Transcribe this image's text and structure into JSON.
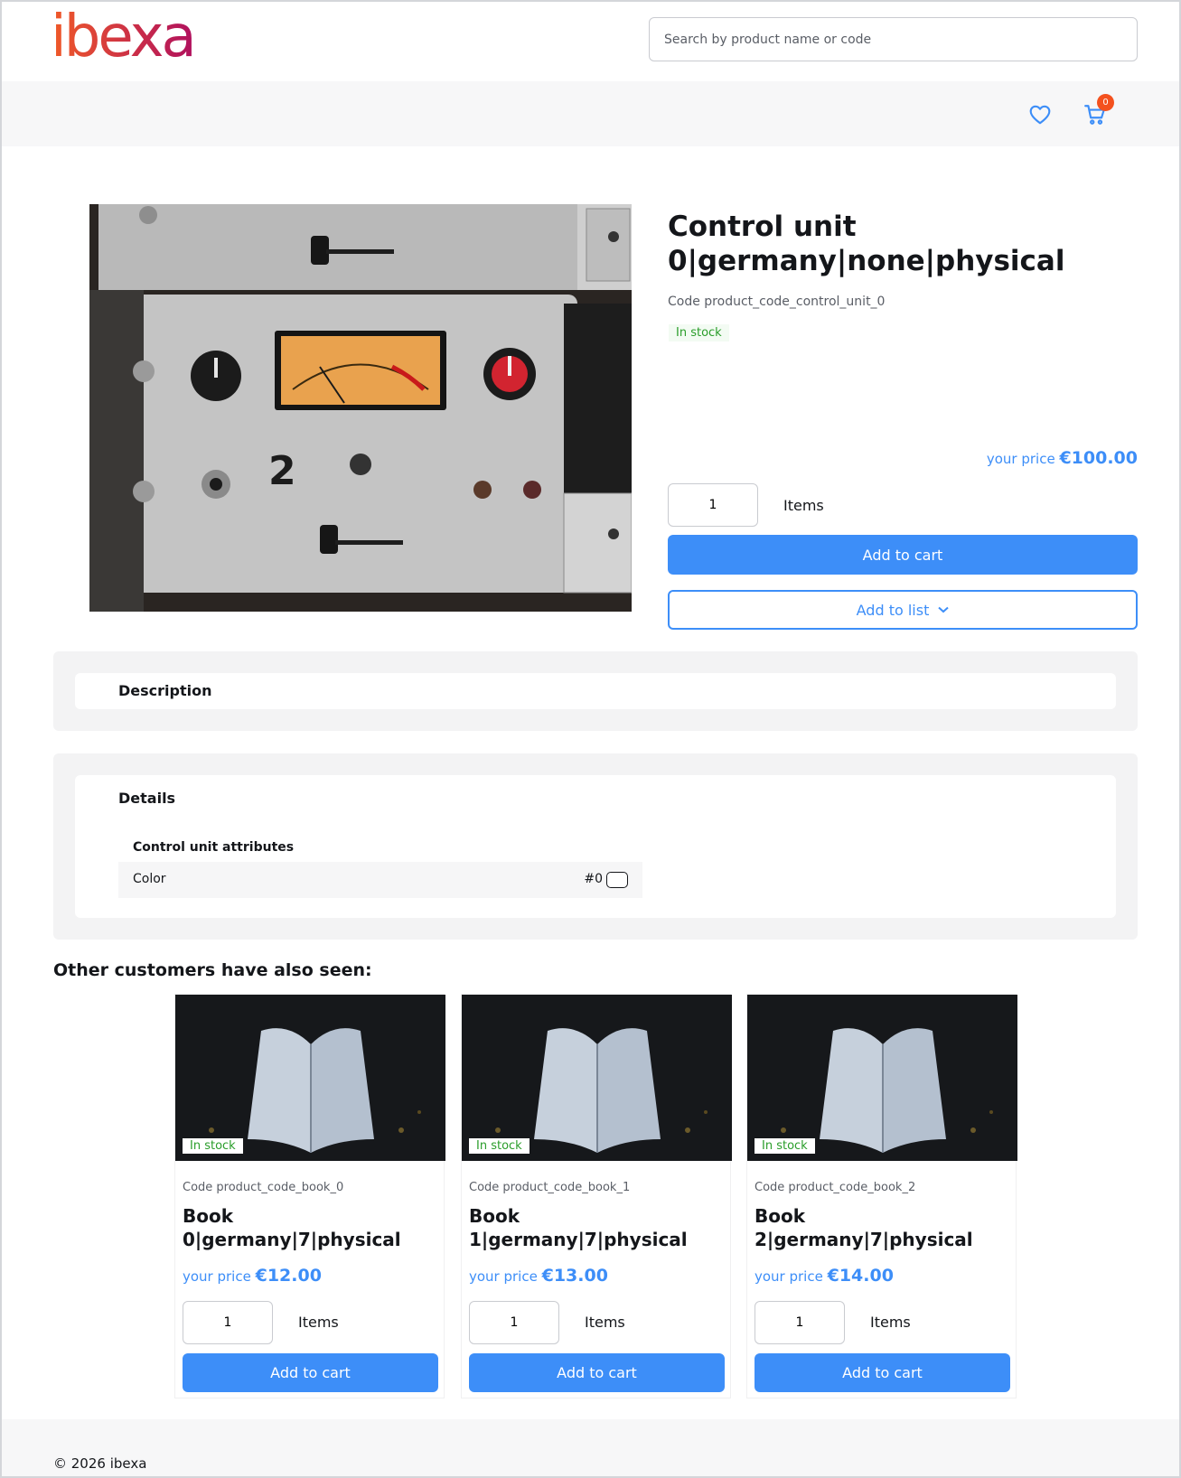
{
  "header": {
    "logo_text": "ibexa",
    "search_placeholder": "Search by product name or code",
    "cart_count": "0"
  },
  "product": {
    "title": "Control unit 0|germany|none|physical",
    "code": "Code product_code_control_unit_0",
    "stock": "In stock",
    "price_label": "your price",
    "price": "€100.00",
    "quantity": "1",
    "items_label": "Items",
    "add_to_cart": "Add to cart",
    "add_to_list": "Add to list"
  },
  "description": {
    "title": "Description"
  },
  "details": {
    "title": "Details",
    "attributes_title": "Control unit attributes",
    "attributes": [
      {
        "name": "Color",
        "value": "#0"
      }
    ]
  },
  "recommendations": {
    "title": "Other customers have also seen:",
    "items": [
      {
        "stock": "In stock",
        "code": "Code product_code_book_0",
        "title": "Book 0|germany|7|physical",
        "price_label": "your price",
        "price": "€12.00",
        "quantity": "1",
        "items_label": "Items",
        "add_to_cart": "Add to cart"
      },
      {
        "stock": "In stock",
        "code": "Code product_code_book_1",
        "title": "Book 1|germany|7|physical",
        "price_label": "your price",
        "price": "€13.00",
        "quantity": "1",
        "items_label": "Items",
        "add_to_cart": "Add to cart"
      },
      {
        "stock": "In stock",
        "code": "Code product_code_book_2",
        "title": "Book 2|germany|7|physical",
        "price_label": "your price",
        "price": "€14.00",
        "quantity": "1",
        "items_label": "Items",
        "add_to_cart": "Add to cart"
      }
    ]
  },
  "footer": {
    "copyright": "© 2026 ibexa"
  },
  "colors": {
    "accent": "#3d8ef8",
    "stock": "#2a9d2a",
    "badge": "#f4511e",
    "logo_start": "#f05a28",
    "logo_end": "#b0105e"
  }
}
